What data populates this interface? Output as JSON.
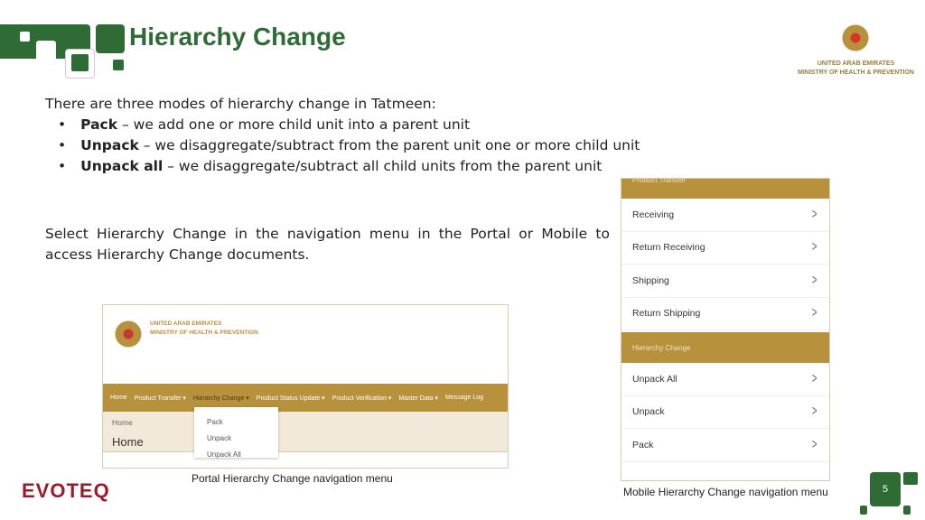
{
  "header": {
    "title": "Hierarchy Change",
    "org_line1": "UNITED ARAB EMIRATES",
    "org_line2": "MINISTRY OF HEALTH & PREVENTION"
  },
  "intro": "There are three modes of hierarchy change in Tatmeen:",
  "modes": [
    {
      "term": "Pack",
      "desc": " – we add one or more child unit into a parent unit"
    },
    {
      "term": "Unpack",
      "desc": " – we disaggregate/subtract from the parent unit one or more child unit"
    },
    {
      "term": "Unpack all",
      "desc": " –  we disaggregate/subtract all child units from the parent unit"
    }
  ],
  "instruction": "Select Hierarchy Change in the navigation menu in the Portal or Mobile to access Hierarchy Change documents.",
  "portal": {
    "org_line1": "UNITED ARAB EMIRATES",
    "org_line2": "MINISTRY OF HEALTH & PREVENTION",
    "nav": [
      "Home",
      "Product Transfer ▾",
      "Hierarchy Change ▾",
      "Product Status Update ▾",
      "Product Verification ▾",
      "Master Data ▾",
      "Message Log"
    ],
    "breadcrumb": "Home",
    "page_title": "Home",
    "dropdown": [
      "Pack",
      "Unpack",
      "Unpack All"
    ],
    "caption": "Portal Hierarchy Change navigation menu"
  },
  "mobile": {
    "section1": "Product Transfer",
    "items1": [
      "Receiving",
      "Return Receiving",
      "Shipping",
      "Return Shipping"
    ],
    "section2": "Hierarchy Change",
    "items2": [
      "Unpack All",
      "Unpack",
      "Pack"
    ],
    "caption": "Mobile Hierarchy Change navigation menu"
  },
  "footer": {
    "logo": "EVOTEQ",
    "page_number": "5"
  },
  "colors": {
    "green": "#2e6b35",
    "gold": "#b8913d",
    "evoteq": "#9b1b2a"
  }
}
